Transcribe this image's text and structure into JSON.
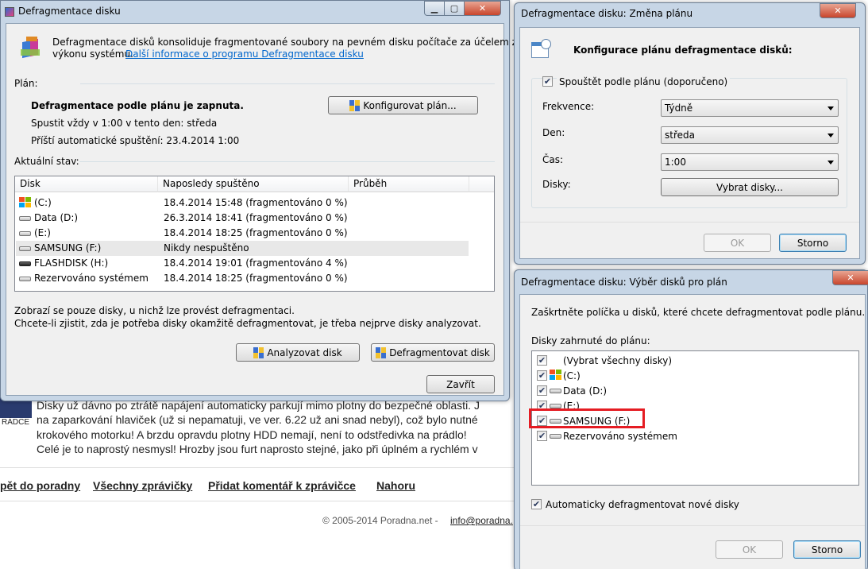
{
  "background": {
    "logo_label": "RÁDCE",
    "article_lines": [
      "Disky už dávno po ztrátě napájení automaticky parkují mimo plotny do bezpečné oblasti. J",
      "na zaparkování hlaviček (už si nepamatuji, ve ver. 6.22 už ani snad nebyl), což bylo nutné",
      "krokového motorku! A brzdu opravdu plotny HDD nemají, není to odstředivka na prádlo!",
      "Celé je to naprostý nesmysl! Hrozby jsou furt naprosto stejné, jako při úplném a rychlém v"
    ],
    "links": [
      "pět do poradny",
      "Všechny zprávičky",
      "Přidat komentář k zprávičce",
      "Nahoru"
    ],
    "footer_copyright": "© 2005-2014 Poradna.net -",
    "footer_email": "info@poradna."
  },
  "main_window": {
    "title": "Defragmentace disku",
    "description": "Defragmentace disků konsoliduje fragmentované soubory na pevném disku počítače za účelem zvýšení",
    "description_line2": "výkonu systému.",
    "more_info_link": "Další informace o programu Defragmentace disku",
    "plan_label": "Plán:",
    "plan_status": "Defragmentace podle plánu je zapnuta.",
    "plan_schedule": "Spustit vždy v 1:00 v tento den: středa",
    "next_run": "Příští automatické spuštění: 23.4.2014 1:00",
    "configure_button": "Konfigurovat plán...",
    "current_status_label": "Aktuální stav:",
    "columns": [
      "Disk",
      "Naposledy spuštěno",
      "Průběh"
    ],
    "disks": [
      {
        "name": "(C:)",
        "last_run": "18.4.2014 15:48 (fragmentováno 0 %)",
        "icon": "windows-drive-icon"
      },
      {
        "name": "Data (D:)",
        "last_run": "26.3.2014 18:41 (fragmentováno 0 %)",
        "icon": "hard-drive-icon"
      },
      {
        "name": "(E:)",
        "last_run": "18.4.2014 18:25 (fragmentováno 0 %)",
        "icon": "hard-drive-icon"
      },
      {
        "name": "SAMSUNG (F:)",
        "last_run": "Nikdy nespuštěno",
        "icon": "hard-drive-icon",
        "selected": true
      },
      {
        "name": "FLASHDISK (H:)",
        "last_run": "18.4.2014 19:01 (fragmentováno 4 %)",
        "icon": "usb-drive-icon"
      },
      {
        "name": "Rezervováno systémem",
        "last_run": "18.4.2014 18:25 (fragmentováno 0 %)",
        "icon": "hard-drive-icon"
      }
    ],
    "note1": "Zobrazí se pouze disky, u nichž lze provést defragmentaci.",
    "note2": "Chcete-li zjistit, zda je potřeba disky okamžitě defragmentovat, je třeba nejprve disky analyzovat.",
    "analyze_button": "Analyzovat disk",
    "defrag_button": "Defragmentovat disk",
    "close_button": "Zavřít"
  },
  "schedule_window": {
    "title": "Defragmentace disku: Změna plánu",
    "heading": "Konfigurace plánu defragmentace disků:",
    "run_on_schedule_checked": true,
    "run_on_schedule": "Spouštět podle plánu (doporučeno)",
    "frequency_label": "Frekvence:",
    "frequency_value": "Týdně",
    "day_label": "Den:",
    "day_value": "středa",
    "time_label": "Čas:",
    "time_value": "1:00",
    "disks_label": "Disky:",
    "select_disks_button": "Vybrat disky...",
    "ok_button": "OK",
    "cancel_button": "Storno"
  },
  "select_window": {
    "title": "Defragmentace disku: Výběr disků pro plán",
    "instruction": "Zaškrtněte políčka u disků, které chcete defragmentovat podle plánu.",
    "included_label": "Disky zahrnuté do plánu:",
    "items": [
      {
        "label": "(Vybrat všechny disky)",
        "checked": true,
        "icon": ""
      },
      {
        "label": "(C:)",
        "checked": true,
        "icon": "windows-drive-icon"
      },
      {
        "label": "Data (D:)",
        "checked": true,
        "icon": "hard-drive-icon"
      },
      {
        "label": "(E:)",
        "checked": true,
        "icon": "hard-drive-icon"
      },
      {
        "label": "SAMSUNG (F:)",
        "checked": true,
        "icon": "hard-drive-icon",
        "highlighted": true
      },
      {
        "label": "Rezervováno systémem",
        "checked": true,
        "icon": "hard-drive-icon"
      }
    ],
    "auto_defrag_checked": true,
    "auto_defrag": "Automaticky defragmentovat nové disky",
    "ok_button": "OK",
    "cancel_button": "Storno"
  },
  "colors": {
    "highlight": "#e51c23",
    "link": "#0066cc",
    "selection": "#e8e8e8"
  }
}
